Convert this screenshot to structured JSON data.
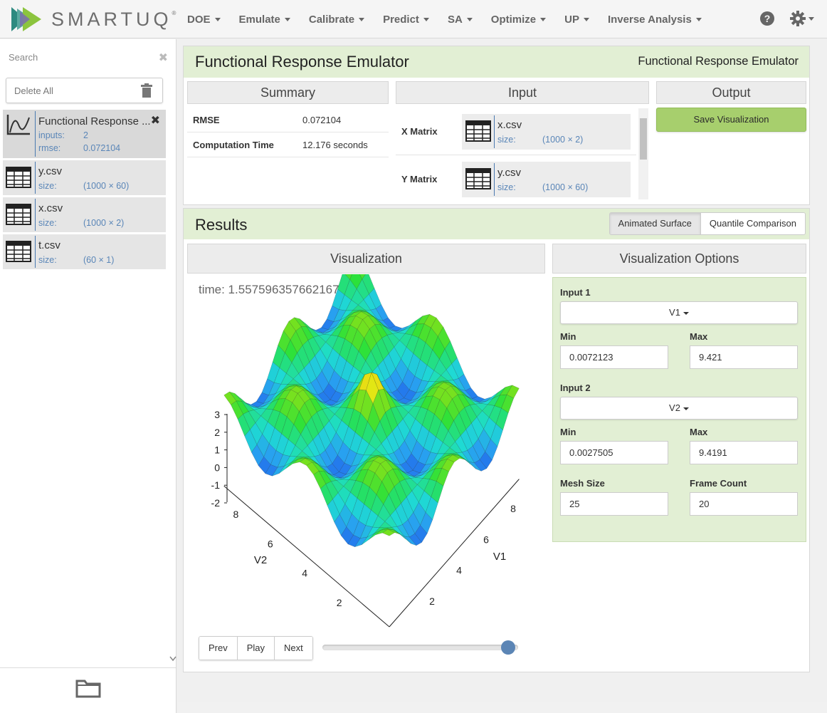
{
  "app": {
    "brand": "SMARTUQ",
    "brand_mark": "®"
  },
  "nav": {
    "items": [
      "DOE",
      "Emulate",
      "Calibrate",
      "Predict",
      "SA",
      "Optimize",
      "UP",
      "Inverse Analysis"
    ],
    "help": "?"
  },
  "sidebar": {
    "search_placeholder": "Search",
    "search_clear": "✖",
    "delete_all": "Delete All",
    "items": [
      {
        "name": "Functional Response ...",
        "meta": [
          {
            "k": "inputs:",
            "v": "2"
          },
          {
            "k": "rmse:",
            "v": "0.072104"
          }
        ],
        "close": "✖"
      },
      {
        "name": "y.csv",
        "meta": [
          {
            "k": "size:",
            "v": "(1000 × 60)"
          }
        ]
      },
      {
        "name": "x.csv",
        "meta": [
          {
            "k": "size:",
            "v": "(1000 × 2)"
          }
        ]
      },
      {
        "name": "t.csv",
        "meta": [
          {
            "k": "size:",
            "v": "(60 × 1)"
          }
        ]
      }
    ]
  },
  "emulator": {
    "title": "Functional Response Emulator",
    "subtitle": "Functional Response Emulator",
    "summary": {
      "heading": "Summary",
      "rows": [
        {
          "k": "RMSE",
          "v": "0.072104"
        },
        {
          "k": "Computation Time",
          "v": "12.176 seconds"
        }
      ]
    },
    "input": {
      "heading": "Input",
      "rows": [
        {
          "k": "X Matrix",
          "file": "x.csv",
          "meta_k": "size:",
          "meta_v": "(1000 × 2)"
        },
        {
          "k": "Y Matrix",
          "file": "y.csv",
          "meta_k": "size:",
          "meta_v": "(1000 × 60)"
        }
      ]
    },
    "output": {
      "heading": "Output",
      "save_button": "Save Visualization"
    }
  },
  "results": {
    "title": "Results",
    "tabs": [
      "Animated Surface",
      "Quantile Comparison"
    ],
    "active_tab": "Animated Surface",
    "visualization": {
      "heading": "Visualization",
      "time_label": "time: 1.557596357662167",
      "z_ticks": [
        "3",
        "2",
        "1",
        "0",
        "-1",
        "-2"
      ],
      "v1_ticks": [
        "2",
        "4",
        "6",
        "8"
      ],
      "v2_ticks": [
        "2",
        "4",
        "6",
        "8"
      ],
      "v1_label": "V1",
      "v2_label": "V2",
      "controls": [
        "Prev",
        "Play",
        "Next"
      ],
      "frame_slider": 0.95
    },
    "options": {
      "heading": "Visualization Options",
      "input1_label": "Input 1",
      "input1_value": "V1",
      "min_label": "Min",
      "max_label": "Max",
      "input1_min": "0.0072123",
      "input1_max": "9.421",
      "input2_label": "Input 2",
      "input2_value": "V2",
      "input2_min": "0.0027505",
      "input2_max": "9.4191",
      "mesh_label": "Mesh Size",
      "mesh_value": "25",
      "frames_label": "Frame Count",
      "frames_value": "20"
    }
  },
  "colors": {
    "accent_green": "#a7cf6d",
    "panel_green": "#e2efd4",
    "link_blue": "#5a86b8"
  }
}
